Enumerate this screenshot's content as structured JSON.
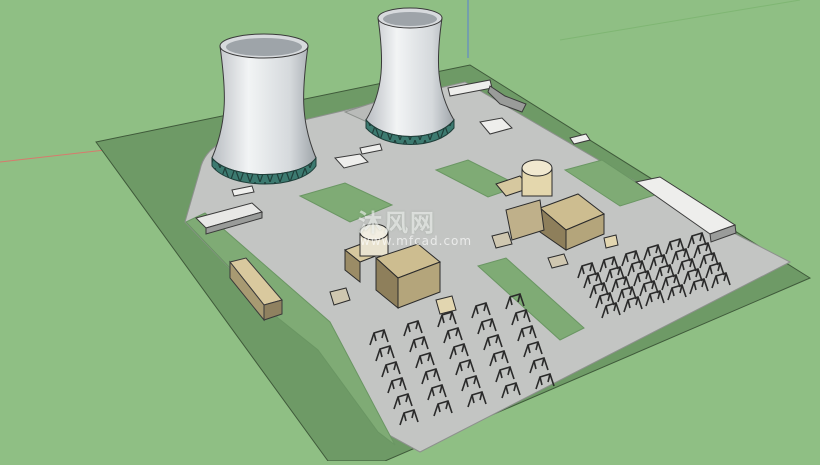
{
  "scene": {
    "description_type": "3d-model-viewport",
    "colors": {
      "ground": "#8fbf84",
      "site_border": "#6e9a66",
      "pavement": "#c3c5c3",
      "lawn": "#7fab75",
      "tower": "#e4e7e9",
      "tower_band": "#356b63",
      "building_tan": "#c9b98e",
      "building_dark": "#6f6345",
      "outline": "#2b2b2b"
    }
  },
  "watermark": {
    "brand": "沐风网",
    "url": "www.mfcad.com"
  }
}
